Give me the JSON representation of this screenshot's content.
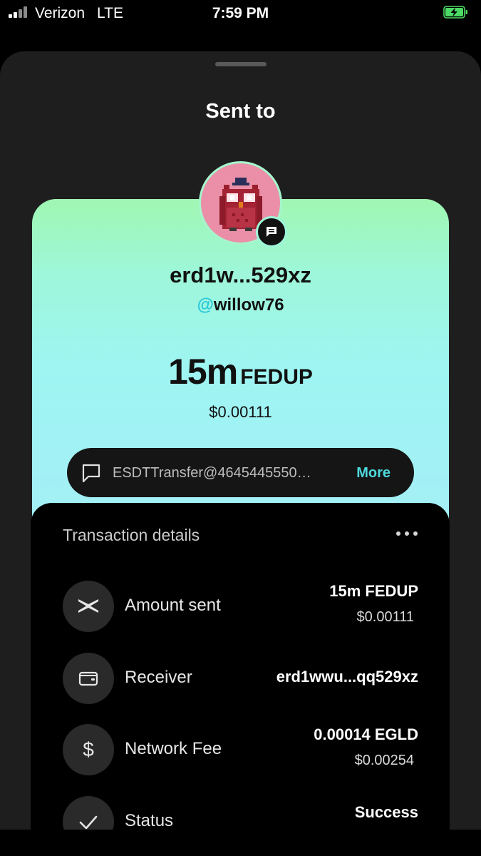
{
  "status_bar": {
    "carrier": "Verizon",
    "network": "LTE",
    "time": "7:59 PM",
    "battery_icon": "battery-charging-icon"
  },
  "sheet": {
    "title": "Sent to"
  },
  "recipient": {
    "address_short": "erd1w...529xz",
    "handle_prefix": "@",
    "handle_name": "willow76",
    "avatar": "pixel-owl-avatar"
  },
  "amount": {
    "value": "15m",
    "token": "FEDUP",
    "usd": "$0.00111"
  },
  "memo": {
    "text": "ESDTTransfer@4645445550…",
    "more_label": "More"
  },
  "details": {
    "title": "Transaction details",
    "rows": [
      {
        "icon": "multiversx-icon",
        "label": "Amount sent",
        "value": "15m FEDUP",
        "sub": "$0.00111"
      },
      {
        "icon": "wallet-icon",
        "label": "Receiver",
        "value": "erd1wwu...qq529xz",
        "sub": ""
      },
      {
        "icon": "dollar-icon",
        "label": "Network Fee",
        "value": "0.00014 EGLD",
        "sub": "$0.00254"
      },
      {
        "icon": "check-icon",
        "label": "Status",
        "value": "Success",
        "sub": ""
      }
    ]
  },
  "colors": {
    "accent": "#4fd9dd",
    "card_gradient_top": "#9ff7b2",
    "card_gradient_bottom": "#a6edf7",
    "sheet_bg": "#1e1e1e"
  }
}
